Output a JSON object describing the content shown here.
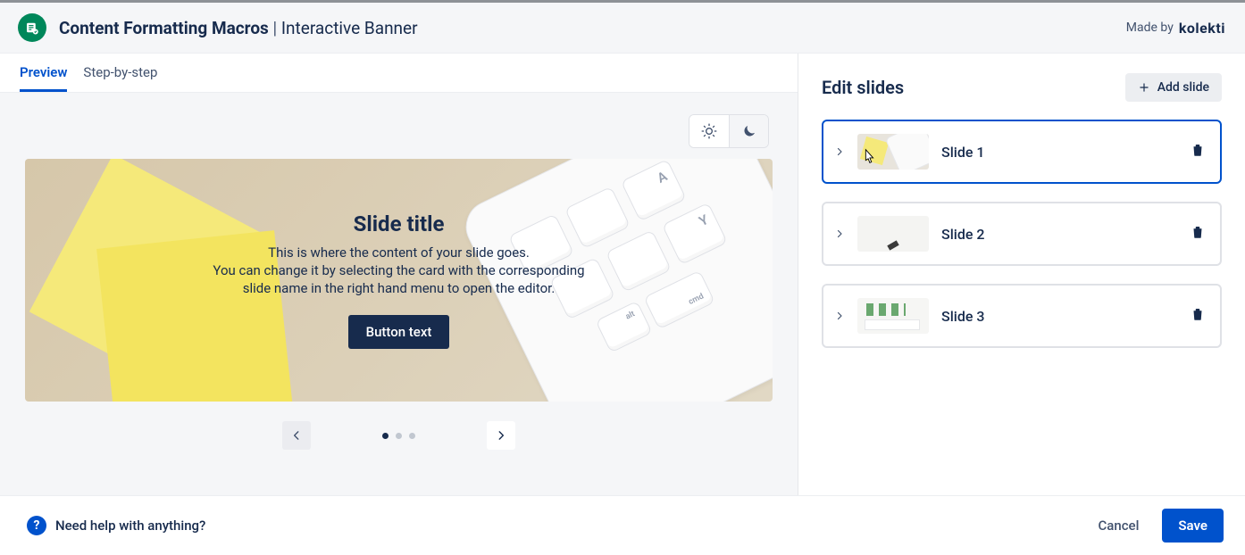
{
  "header": {
    "title_strong": "Content Formatting Macros",
    "title_sub": "Interactive Banner",
    "made_by_label": "Made by",
    "brand": "kolekti"
  },
  "tabs": [
    {
      "label": "Preview",
      "active": true
    },
    {
      "label": "Step-by-step",
      "active": false
    }
  ],
  "slide": {
    "title": "Slide title",
    "body": "This is where the content of your slide goes.\nYou can change it by selecting the card with the corresponding\nslide name in the right hand menu to open the editor.",
    "button_label": "Button text"
  },
  "keyboard_keys": {
    "k3": "A",
    "k6": "Y",
    "k7": "alt",
    "k8": "cmd"
  },
  "pager": {
    "count": 3,
    "active_index": 0
  },
  "right": {
    "heading": "Edit slides",
    "add_label": "Add slide",
    "slides": [
      {
        "name": "Slide 1",
        "selected": true
      },
      {
        "name": "Slide 2",
        "selected": false
      },
      {
        "name": "Slide 3",
        "selected": false
      }
    ]
  },
  "footer": {
    "help_label": "Need help with anything?",
    "cancel_label": "Cancel",
    "save_label": "Save"
  }
}
